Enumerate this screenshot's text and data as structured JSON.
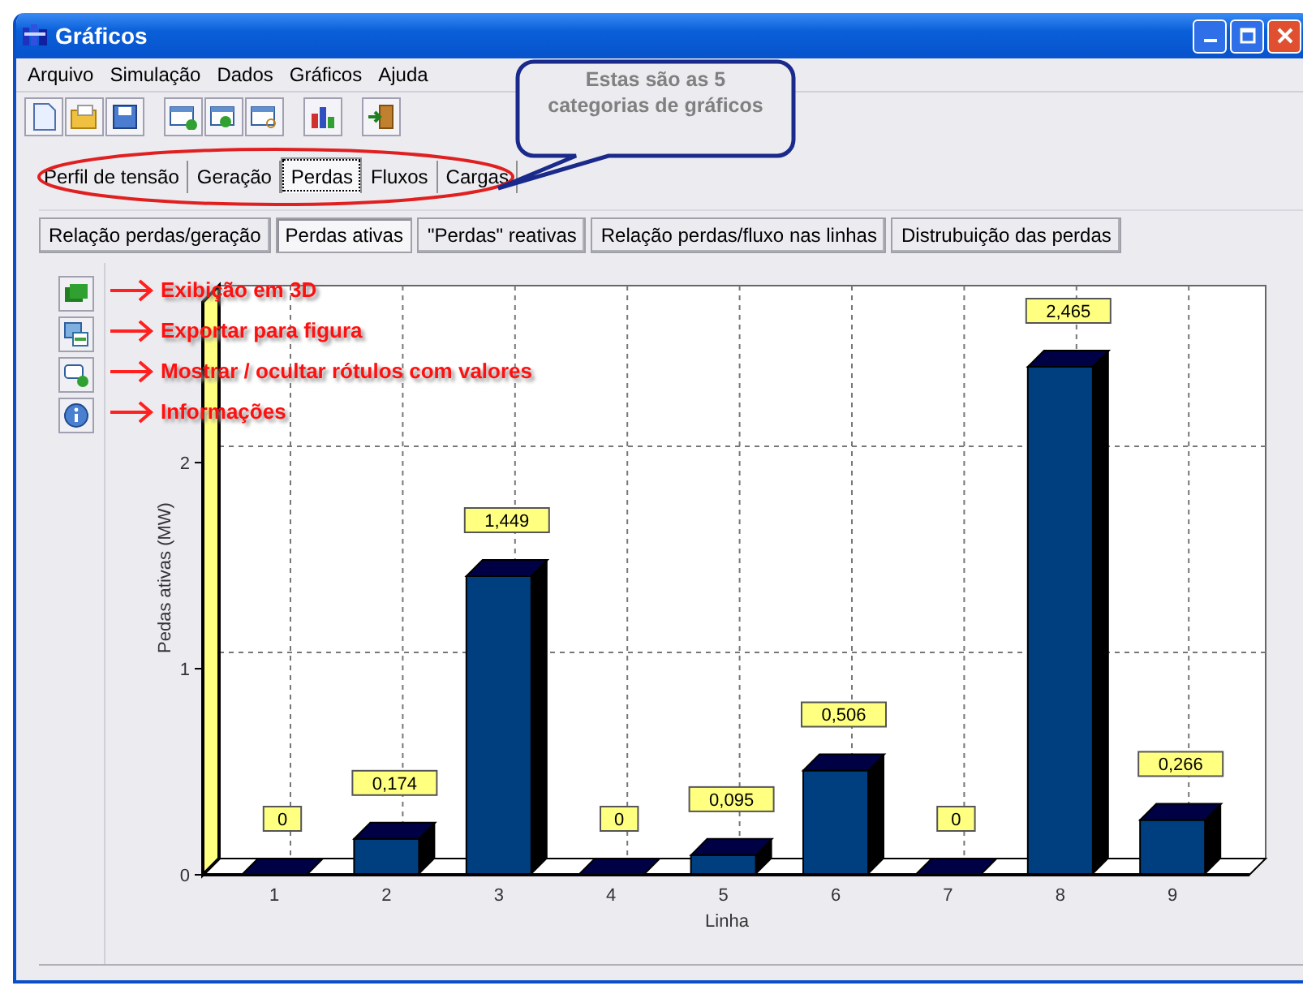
{
  "window": {
    "title": "Gráficos"
  },
  "menu": [
    "Arquivo",
    "Simulação",
    "Dados",
    "Gráficos",
    "Ajuda"
  ],
  "tabs": [
    {
      "label": "Perfil de tensão",
      "selected": false
    },
    {
      "label": "Geração",
      "selected": false
    },
    {
      "label": "Perdas",
      "selected": true
    },
    {
      "label": "Fluxos",
      "selected": false
    },
    {
      "label": "Cargas",
      "selected": false
    }
  ],
  "subtabs": [
    {
      "label": "Relação perdas/geração",
      "selected": false
    },
    {
      "label": "Perdas ativas",
      "selected": true
    },
    {
      "label": "\"Perdas\" reativas",
      "selected": false
    },
    {
      "label": "Relação perdas/fluxo nas linhas",
      "selected": false
    },
    {
      "label": "Distrubuição das perdas",
      "selected": false
    }
  ],
  "chart": {
    "chart_data": {
      "type": "bar",
      "xlabel": "Linha",
      "ylabel": "Pedas ativas (MW)",
      "categories": [
        "1",
        "2",
        "3",
        "4",
        "5",
        "6",
        "7",
        "8",
        "9"
      ],
      "values": [
        0,
        0.174,
        1.449,
        0,
        0.095,
        0.506,
        0,
        2.465,
        0.266
      ],
      "yticks": [
        0,
        1,
        2
      ],
      "ylim": [
        0,
        2.78
      ],
      "value_labels": [
        "0",
        "0,174",
        "1,449",
        "0",
        "0,095",
        "0,506",
        "0",
        "2,465",
        "0,266"
      ]
    }
  },
  "annotations": {
    "callout": "Estas são as 5 categorias de gráficos",
    "labels": [
      "Exibição em 3D",
      "Exportar para figura",
      "Mostrar / ocultar rótulos com valores",
      "Informações"
    ]
  }
}
